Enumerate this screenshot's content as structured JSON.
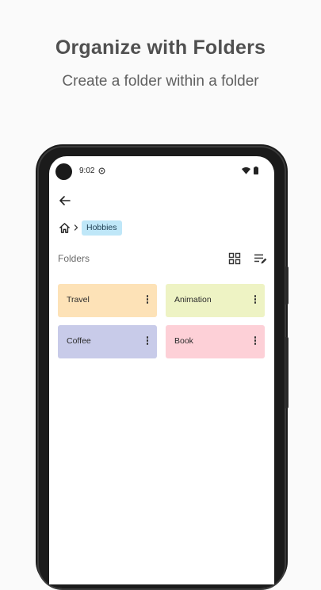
{
  "promo": {
    "title": "Organize with Folders",
    "subtitle": "Create a folder within a folder"
  },
  "status_bar": {
    "time": "9:02",
    "icons": [
      "notification-icon",
      "wifi-icon",
      "battery-icon"
    ]
  },
  "toolbar": {
    "back_icon": "arrow-left-icon"
  },
  "breadcrumb": {
    "home_icon": "home-icon",
    "separator_icon": "chevron-right-icon",
    "current": "Hobbies"
  },
  "section": {
    "title": "Folders",
    "view_icon": "grid-view-icon",
    "sort_icon": "sort-edit-icon"
  },
  "folders": [
    {
      "name": "Travel",
      "color": "#fde2b7"
    },
    {
      "name": "Animation",
      "color": "#eef3c4"
    },
    {
      "name": "Coffee",
      "color": "#c8cbe9"
    },
    {
      "name": "Book",
      "color": "#fdd0d7"
    }
  ]
}
